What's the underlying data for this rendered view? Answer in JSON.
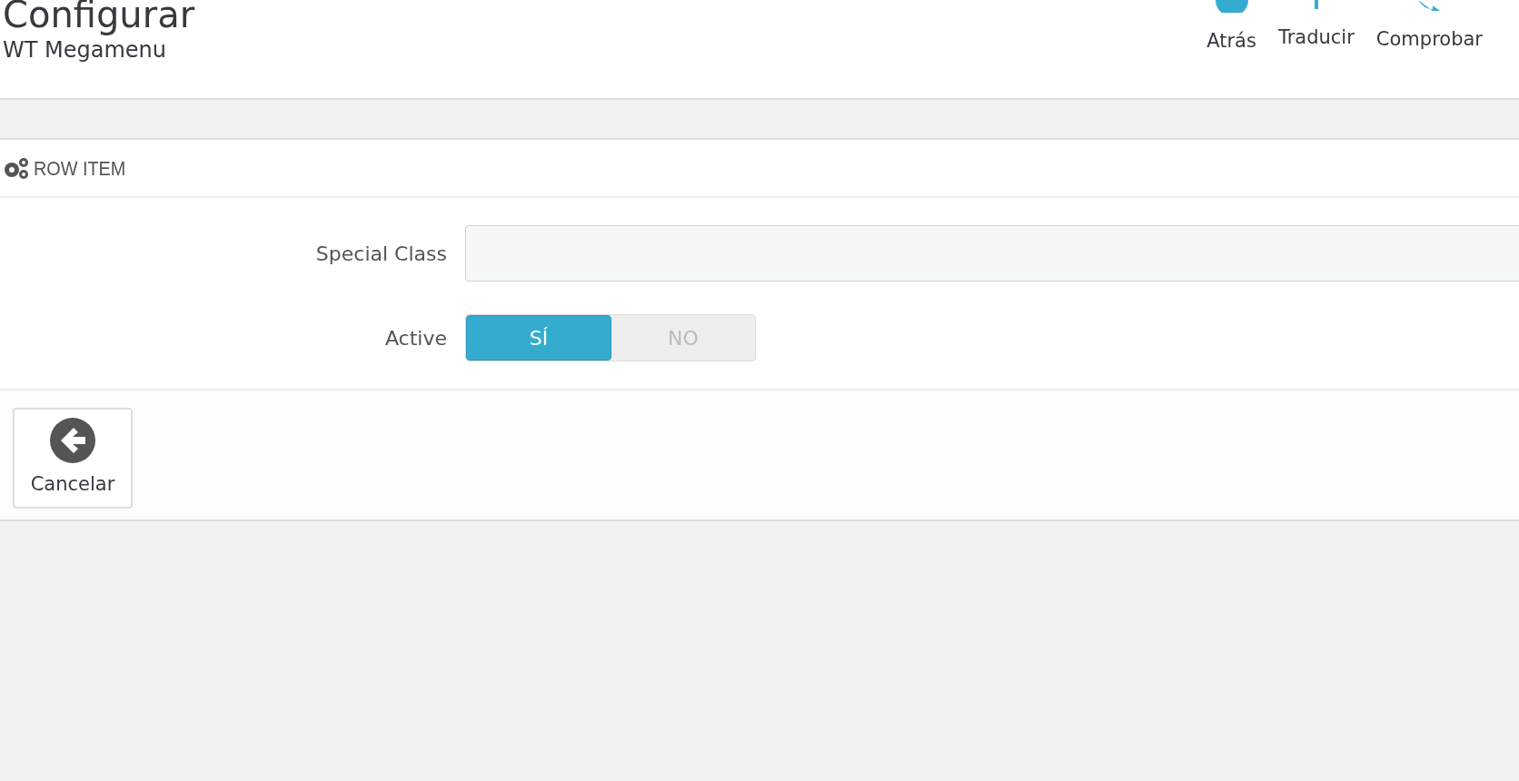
{
  "page_header": {
    "title": "Configurar",
    "subtitle": "WT Megamenu"
  },
  "toolbar": [
    {
      "label": "Atrás",
      "kind": "back"
    },
    {
      "label": "Traducir",
      "kind": "translate"
    },
    {
      "label": "Comprobar",
      "kind": "check"
    }
  ],
  "panel": {
    "heading": "ROW ITEM",
    "fields": [
      {
        "kind": "text",
        "label": "Special Class"
      },
      {
        "kind": "toggle",
        "label": "Active",
        "options": [
          {
            "label": "SÍ",
            "selected": true
          },
          {
            "label": "NO",
            "selected": false
          }
        ]
      }
    ],
    "footer_buttons": [
      {
        "label": "Cancelar"
      }
    ]
  }
}
